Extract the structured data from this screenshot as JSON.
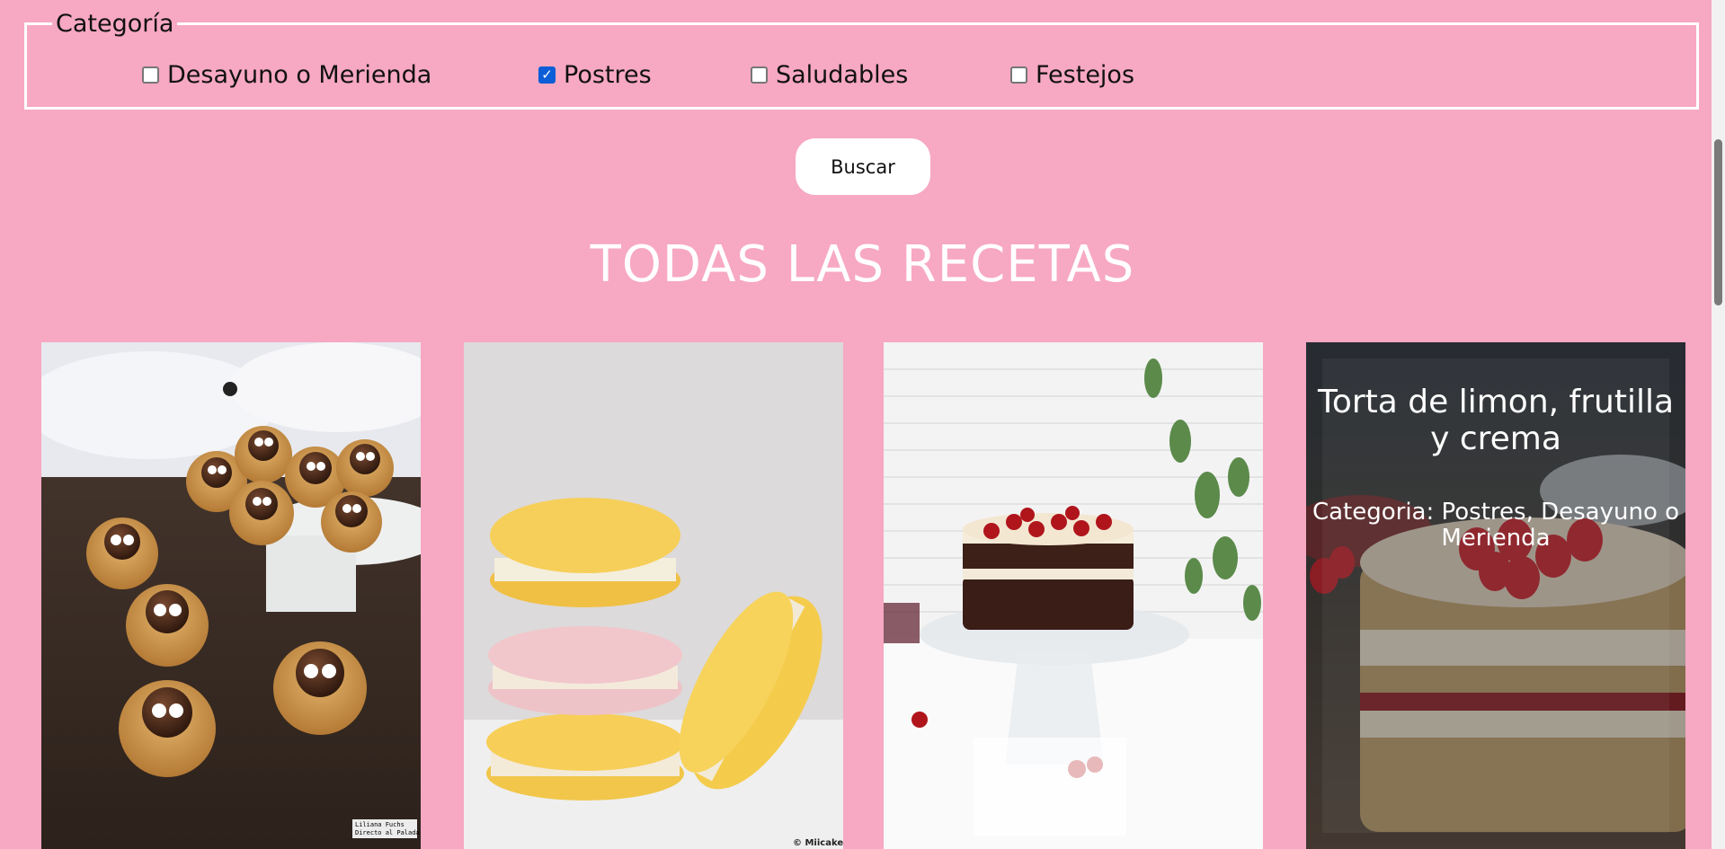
{
  "filters": {
    "legend": "Categoría",
    "options": [
      {
        "label": "Desayuno o Merienda",
        "checked": false
      },
      {
        "label": "Postres",
        "checked": true
      },
      {
        "label": "Saludables",
        "checked": false
      },
      {
        "label": "Festejos",
        "checked": false
      }
    ]
  },
  "search_button": "Buscar",
  "heading": "TODAS LAS RECETAS",
  "cards": [
    {
      "image": "spider-cookies-photo",
      "credit_lines": [
        "Liliana Fuchs",
        "Directo al Paladar"
      ]
    },
    {
      "image": "macarons-photo",
      "credit": "© Miicakes"
    },
    {
      "image": "black-forest-cake-photo"
    },
    {
      "image": "lemon-strawberry-cake-photo",
      "title": "Torta de limon, frutilla y crema",
      "category": "Categoria: Postres, Desayuno o Merienda"
    }
  ]
}
